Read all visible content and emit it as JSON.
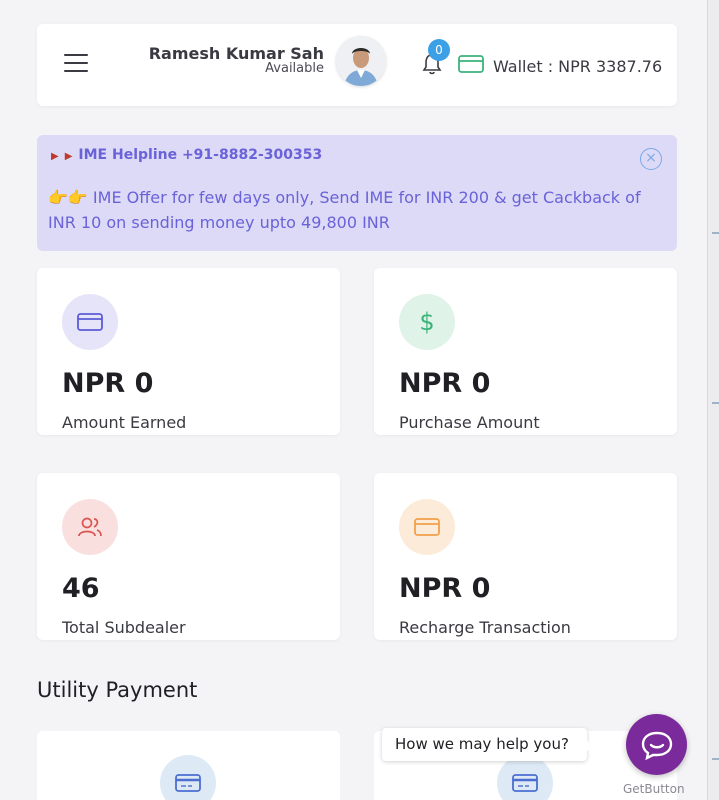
{
  "header": {
    "user_name": "Ramesh Kumar Sah",
    "user_status": "Available",
    "notification_count": "0",
    "wallet_text": "Wallet : NPR 3387.76"
  },
  "notice": {
    "helpline": "IME Helpline +91-8882-300353",
    "close_symbol": "×",
    "message": "👉👉 IME Offer for few days only, Send IME for INR 200 & get Cackback of INR 10 on sending money upto 49,800 INR"
  },
  "stats": [
    {
      "value": "NPR 0",
      "label": "Amount Earned",
      "icon": "card-icon",
      "color": "#5b5bd6",
      "bg": "#e6e4f8"
    },
    {
      "value": "NPR 0",
      "label": "Purchase Amount",
      "icon": "dollar-icon",
      "color": "#3bb37a",
      "bg": "#dff3e8"
    },
    {
      "value": "46",
      "label": "Total Subdealer",
      "icon": "users-icon",
      "color": "#d9534f",
      "bg": "#f9e0df"
    },
    {
      "value": "NPR 0",
      "label": "Recharge Transaction",
      "icon": "card-icon",
      "color": "#f0a04b",
      "bg": "#fdebd9"
    }
  ],
  "utility": {
    "title": "Utility Payment"
  },
  "chat": {
    "prompt": "How we may help you?",
    "powered_by": "GetButton"
  }
}
